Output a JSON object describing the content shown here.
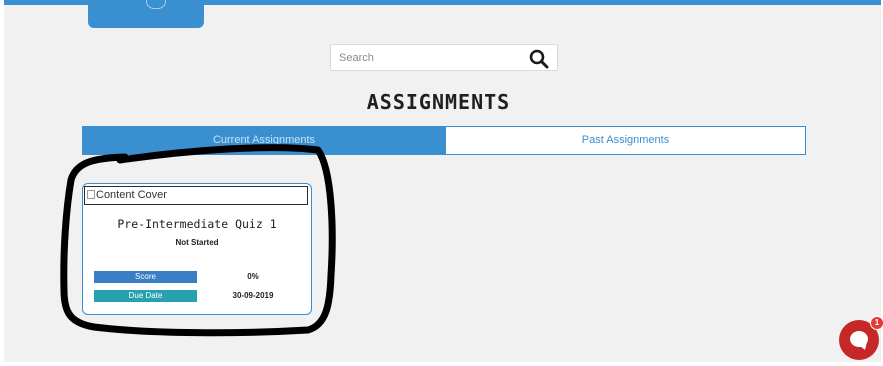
{
  "header": {
    "logo_icon": "school-logo-icon"
  },
  "search": {
    "placeholder": "Search",
    "value": "",
    "icon": "search-icon"
  },
  "page": {
    "title": "ASSIGNMENTS"
  },
  "tabs": [
    {
      "label": "Current Assignments",
      "active": true
    },
    {
      "label": "Past Assignments",
      "active": false
    }
  ],
  "assignments": [
    {
      "cover_alt": "Content Cover",
      "title": "Pre-Intermediate Quiz 1",
      "status": "Not Started",
      "score_label": "Score",
      "score_value": "0%",
      "due_label": "Due Date",
      "due_value": "30-09-2019"
    }
  ],
  "chat": {
    "icon": "chat-icon",
    "badge_count": "1"
  },
  "colors": {
    "primary": "#3a8fd0",
    "score_label_bg": "#3a7ec6",
    "due_label_bg": "#27a1ad",
    "chat_button": "#c62828",
    "annotation_stroke": "#000000"
  }
}
